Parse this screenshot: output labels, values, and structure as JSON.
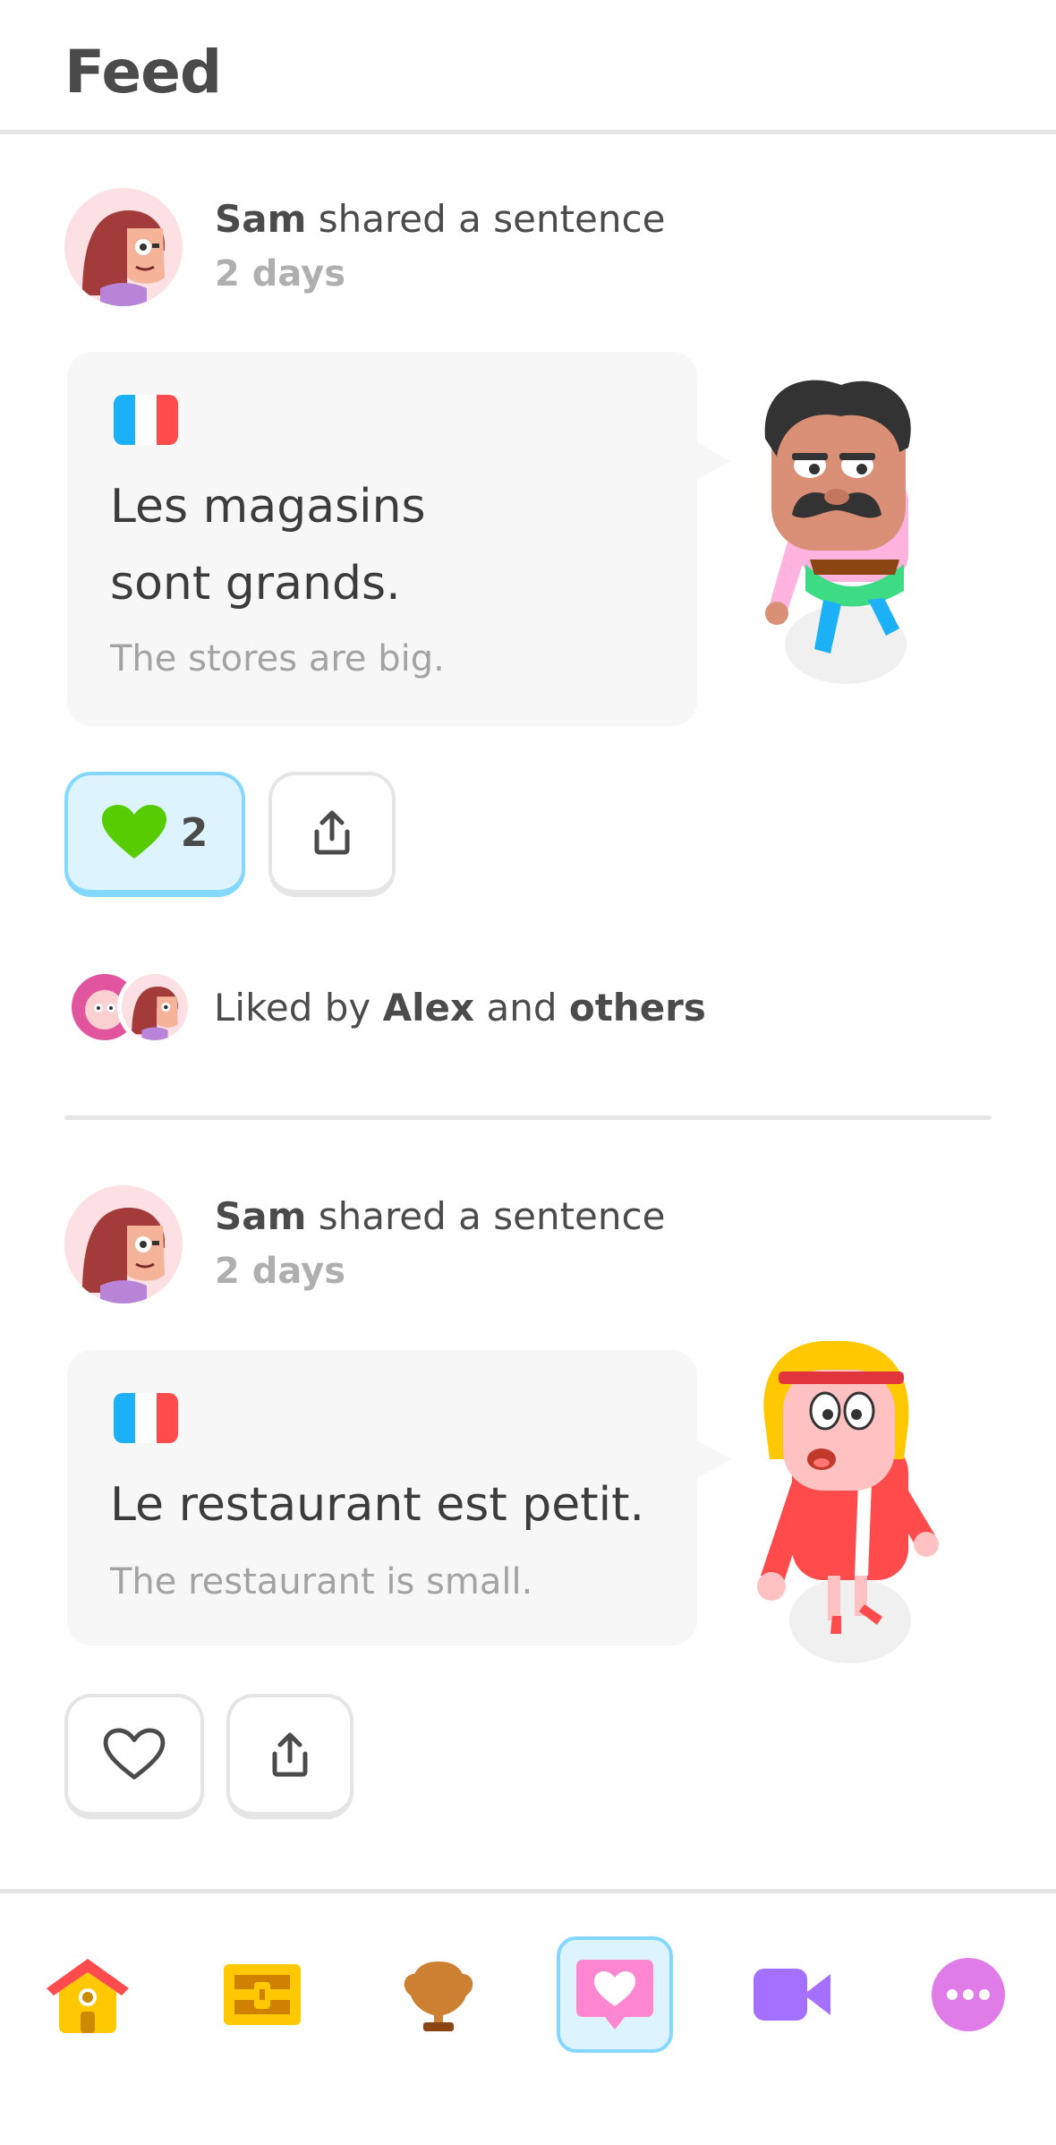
{
  "header": {
    "title": "Feed"
  },
  "posts": [
    {
      "author": "Sam",
      "action": "shared a sentence",
      "time": "2 days",
      "sentence_line1": "Les magasins",
      "sentence_line2": "sont grands.",
      "translation": "The stores are big.",
      "likes": "2",
      "liked": true,
      "liked_by_prefix": "Liked by",
      "liked_by_name": "Alex",
      "liked_by_and": "and",
      "liked_by_others": "others"
    },
    {
      "author": "Sam",
      "action": "shared a sentence",
      "time": "2 days",
      "sentence_line1": "Le restaurant est petit.",
      "translation": "The restaurant is small.",
      "liked": false
    }
  ],
  "tabbar": {
    "items": [
      "home-icon",
      "chest-icon",
      "trophy-icon",
      "feed-icon",
      "video-icon",
      "more-icon"
    ],
    "active": "feed-icon"
  },
  "colors": {
    "like_green": "#58cc02",
    "active_tab_bg": "#ddf4ff",
    "active_tab_border": "#84d8ff",
    "flag_blue": "#1cb0f6",
    "flag_red": "#ff4b4b"
  }
}
